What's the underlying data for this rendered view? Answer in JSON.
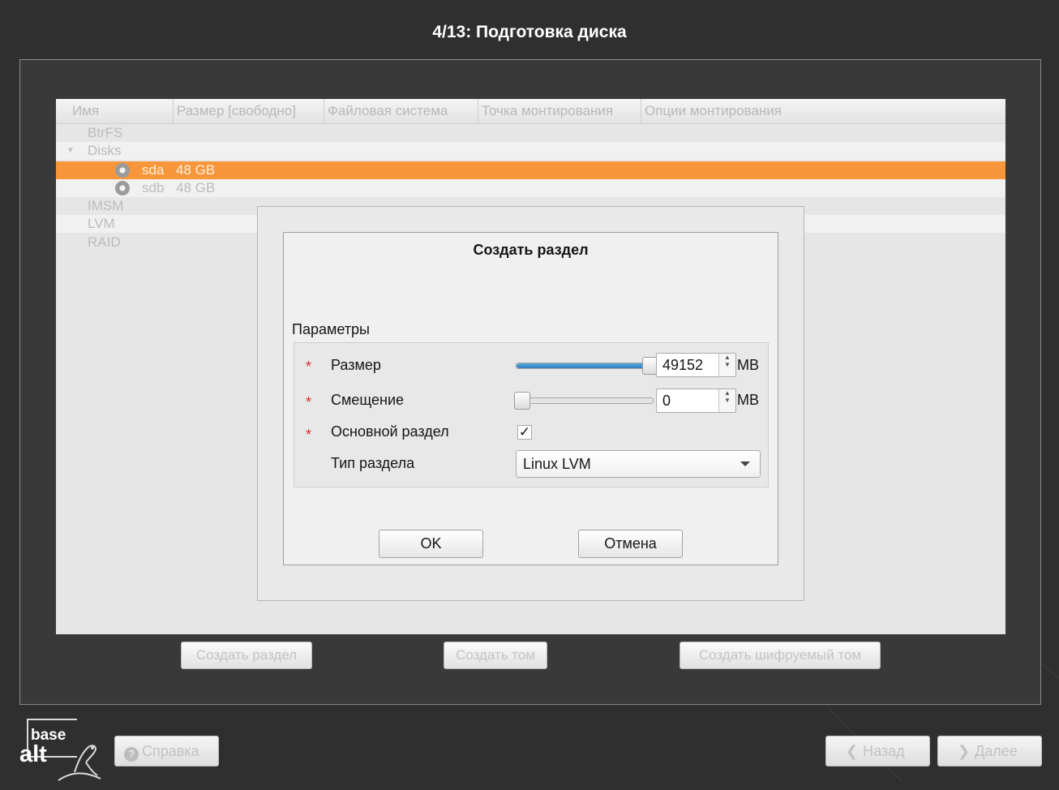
{
  "window": {
    "title": "4/13: Подготовка диска"
  },
  "table": {
    "columns": [
      "Имя",
      "Размер [свободно]",
      "Файловая система",
      "Точка монтирования",
      "Опции монтирования"
    ],
    "rows": [
      {
        "name": "BtrFS",
        "size": ""
      },
      {
        "name": "Disks",
        "size": "",
        "expanded": true
      },
      {
        "name": "sda",
        "size": "48 GB",
        "selected": true,
        "icon": "disk-icon"
      },
      {
        "name": "sdb",
        "size": "48 GB",
        "icon": "disk-icon"
      },
      {
        "name": "IMSM",
        "size": ""
      },
      {
        "name": "LVM",
        "size": ""
      },
      {
        "name": "RAID",
        "size": ""
      }
    ]
  },
  "actions": {
    "create_partition": "Создать раздел",
    "create_volume": "Создать том",
    "create_encrypted_volume": "Создать шифруемый том"
  },
  "dialog": {
    "title": "Создать раздел",
    "group_label": "Параметры",
    "fields": {
      "size": {
        "label": "Размер",
        "value": "49152",
        "unit": "MB",
        "slider_fraction": 1.0
      },
      "offset": {
        "label": "Смещение",
        "value": "0",
        "unit": "MB",
        "slider_fraction": 0.0
      },
      "primary": {
        "label": "Основной раздел",
        "checked": true,
        "check_glyph": "✓"
      },
      "type": {
        "label": "Тип раздела",
        "value": "Linux LVM"
      }
    },
    "required_mark": "*",
    "ok_label": "OK",
    "cancel_label": "Отмена"
  },
  "footer": {
    "logo_top": "base",
    "logo_bottom": "alt",
    "help_label": "Справка",
    "back_label": "Назад",
    "next_label": "Далее"
  },
  "colors": {
    "selection": "#f7963a",
    "required": "#d62a2a",
    "slider_fill": "#3a8ccb",
    "background": "#2f2f2f"
  }
}
